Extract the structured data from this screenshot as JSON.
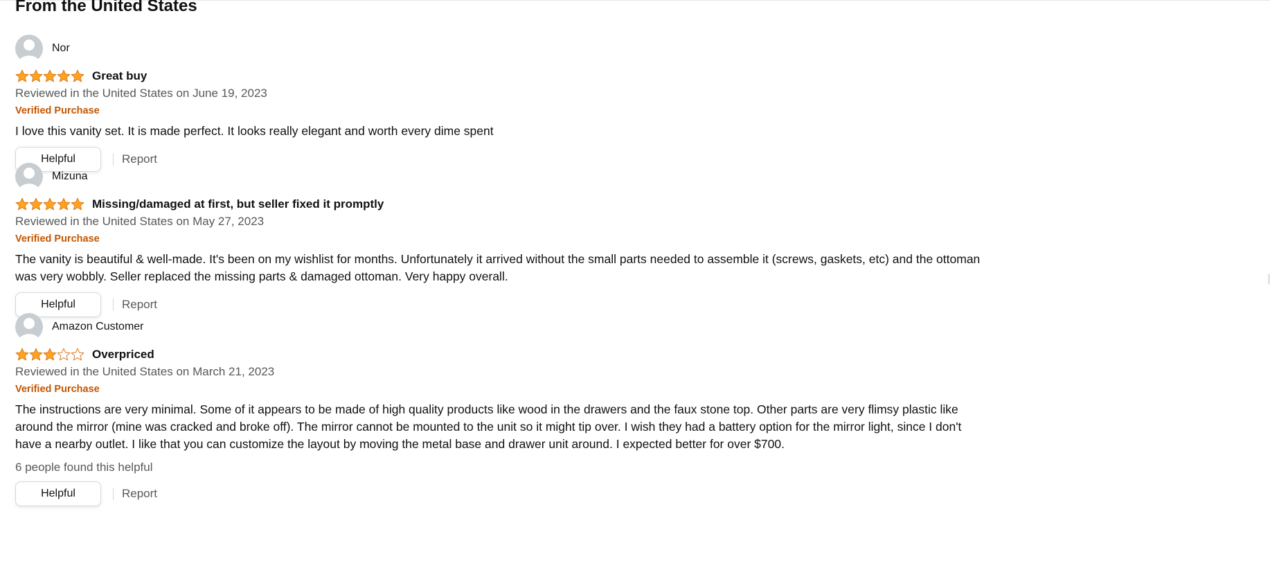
{
  "section": {
    "title": "From the United States"
  },
  "colors": {
    "star": "#ffa41c",
    "star_outline": "#de7921",
    "verified": "#c45500",
    "muted_text": "#565959"
  },
  "reviews": [
    {
      "profile_name": "Nor",
      "rating": 5,
      "rating_max": 5,
      "title": "Great buy",
      "date_text": "Reviewed in the United States on June 19, 2023",
      "badge": "Verified Purchase",
      "body": "I love this vanity set. It is made perfect. It looks really elegant and worth every dime spent",
      "helpful_count_text": "",
      "helpful_label": "Helpful",
      "report_label": "Report"
    },
    {
      "profile_name": "Mizuna",
      "rating": 5,
      "rating_max": 5,
      "title": "Missing/damaged at first, but seller fixed it promptly",
      "date_text": "Reviewed in the United States on May 27, 2023",
      "badge": "Verified Purchase",
      "body": "The vanity is beautiful & well-made. It's been on my wishlist for months. Unfortunately it arrived without the small parts needed to assemble it (screws, gaskets, etc) and the ottoman was very wobbly. Seller replaced the missing parts & damaged ottoman. Very happy overall.",
      "helpful_count_text": "",
      "helpful_label": "Helpful",
      "report_label": "Report"
    },
    {
      "profile_name": "Amazon Customer",
      "rating": 3,
      "rating_max": 5,
      "title": "Overpriced",
      "date_text": "Reviewed in the United States on March 21, 2023",
      "badge": "Verified Purchase",
      "body": "The instructions are very minimal. Some of it appears to be made of high quality products like wood in the drawers and the faux stone top. Other parts are very flimsy plastic like around the mirror (mine was cracked and broke off). The mirror cannot be mounted to the unit so it might tip over. I wish they had a battery option for the mirror light, since I don't have a nearby outlet. I like that you can customize the layout by moving the metal base and drawer unit around. I expected better for over $700.",
      "helpful_count_text": "6 people found this helpful",
      "helpful_label": "Helpful",
      "report_label": "Report"
    }
  ]
}
